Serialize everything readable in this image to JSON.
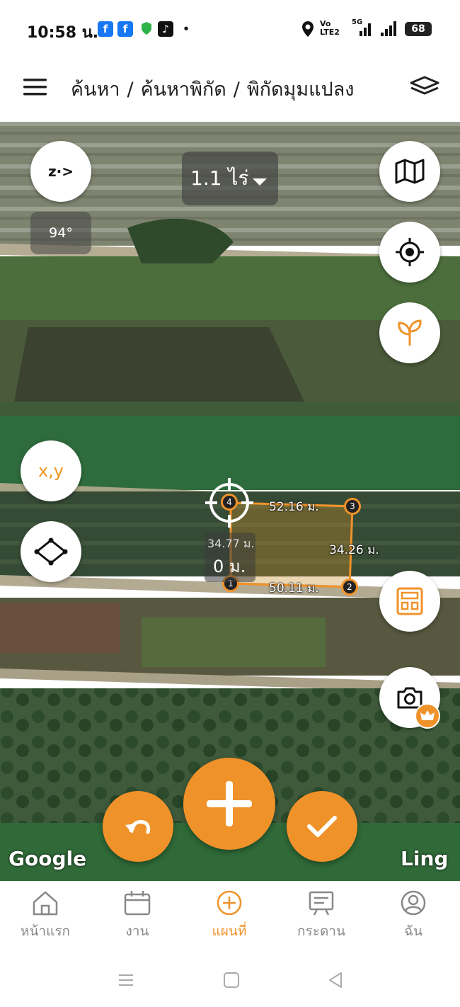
{
  "status_bar": {
    "time": "10:58 น.",
    "network_label": "Vo LTE2",
    "signal_label": "5G",
    "battery": "68"
  },
  "header": {
    "breadcrumb": [
      "ค้นหา",
      "/",
      "ค้นหาพิกัด",
      "/",
      "พิกัดมุมแปลง"
    ]
  },
  "map": {
    "area_label": "1.1 ไร่",
    "compass_label": "z·>",
    "heading": "94°",
    "coord_button": "x,y",
    "points": [
      "1",
      "2",
      "3",
      "4"
    ],
    "edges": {
      "top": "52.16 ม.",
      "right": "34.26 ม.",
      "bottom": "50.11 ม.",
      "left": "34.77 ม."
    },
    "current_distance": "0 ม.",
    "attribution_left": "Google",
    "attribution_right": "Ling"
  },
  "bottom_nav": {
    "items": [
      {
        "label": "หน้าแรก",
        "icon": "home-icon",
        "active": false
      },
      {
        "label": "งาน",
        "icon": "calendar-icon",
        "active": false
      },
      {
        "label": "แผนที่",
        "icon": "add-circle-icon",
        "active": true
      },
      {
        "label": "กระดาน",
        "icon": "board-icon",
        "active": false
      },
      {
        "label": "ฉัน",
        "icon": "profile-icon",
        "active": false
      }
    ]
  },
  "colors": {
    "accent": "#f0922a",
    "nav_inactive": "#888888"
  }
}
